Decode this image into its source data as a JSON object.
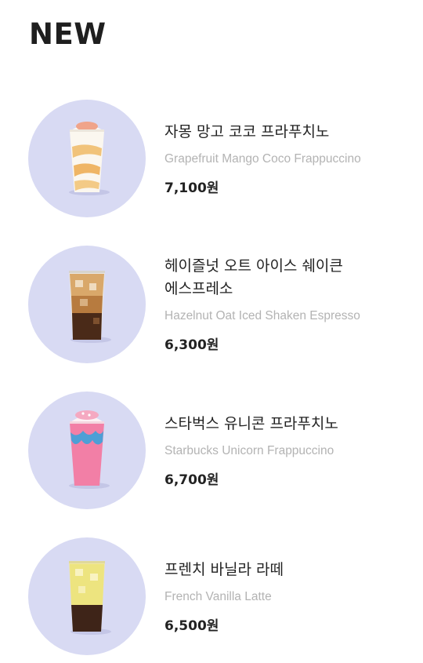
{
  "section": {
    "title": "NEW"
  },
  "colors": {
    "thumb_bg": "#d8daf3",
    "text": "#222222",
    "subtext": "#b3b3b3"
  },
  "items": [
    {
      "name_ko": "자몽 망고 코코 프라푸치노",
      "name_en": "Grapefruit Mango Coco Frappuccino",
      "price": "7,100원",
      "icon": "mango-frappuccino-image"
    },
    {
      "name_ko": "헤이즐넛 오트 아이스 쉐이큰 에스프레소",
      "name_en": "Hazelnut Oat Iced Shaken Espresso",
      "price": "6,300원",
      "icon": "shaken-espresso-image"
    },
    {
      "name_ko": "스타벅스 유니콘 프라푸치노",
      "name_en": "Starbucks Unicorn Frappuccino",
      "price": "6,700원",
      "icon": "unicorn-frappuccino-image"
    },
    {
      "name_ko": "프렌치 바닐라 라떼",
      "name_en": "French Vanilla Latte",
      "price": "6,500원",
      "icon": "vanilla-latte-image"
    }
  ]
}
